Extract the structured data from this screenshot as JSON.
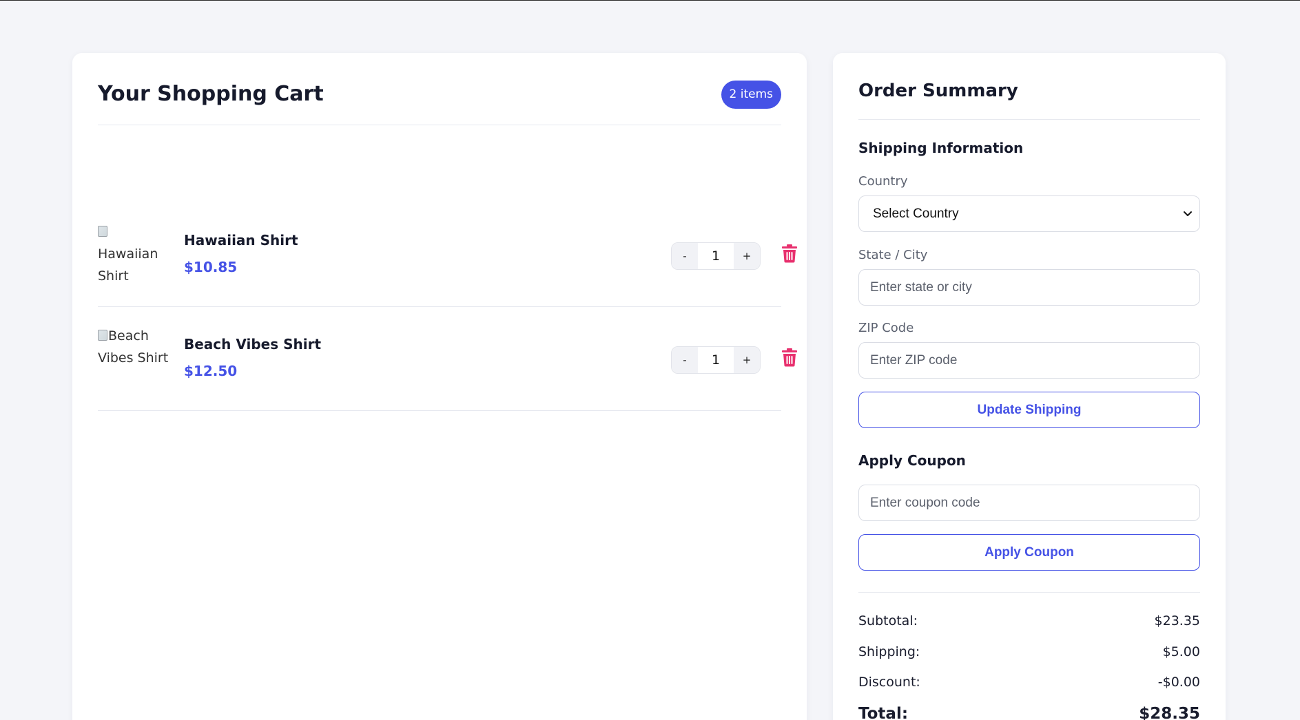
{
  "cart": {
    "title": "Your Shopping Cart",
    "item_count_label": "2 items",
    "items": [
      {
        "image_alt": "Hawaiian Shirt",
        "name": "Hawaiian Shirt",
        "price": "$10.85",
        "quantity": "1",
        "decrement_label": "-",
        "increment_label": "+"
      },
      {
        "image_alt": "Beach Vibes Shirt",
        "name": "Beach Vibes Shirt",
        "price": "$12.50",
        "quantity": "1",
        "decrement_label": "-",
        "increment_label": "+"
      }
    ]
  },
  "summary": {
    "title": "Order Summary",
    "shipping": {
      "section_title": "Shipping Information",
      "country_label": "Country",
      "country_value": "Select Country",
      "state_label": "State / City",
      "state_placeholder": "Enter state or city",
      "zip_label": "ZIP Code",
      "zip_placeholder": "Enter ZIP code",
      "update_button": "Update Shipping"
    },
    "coupon": {
      "section_title": "Apply Coupon",
      "placeholder": "Enter coupon code",
      "apply_button": "Apply Coupon"
    },
    "totals": {
      "subtotal_label": "Subtotal:",
      "subtotal_value": "$23.35",
      "shipping_label": "Shipping:",
      "shipping_value": "$5.00",
      "discount_label": "Discount:",
      "discount_value": "-$0.00",
      "total_label": "Total:",
      "total_value": "$28.35"
    }
  },
  "colors": {
    "accent": "#4552e6",
    "delete": "#e8306e",
    "page_background": "#f4f5f9"
  },
  "icons": {
    "delete": "trash-icon",
    "select": "chevron-down-icon",
    "image": "broken-image-icon"
  }
}
